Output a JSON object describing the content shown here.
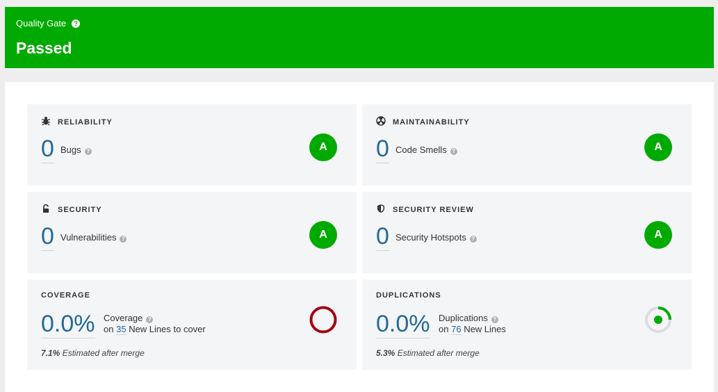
{
  "gate": {
    "label": "Quality Gate",
    "help": "?",
    "status": "Passed"
  },
  "reliability": {
    "title": "RELIABILITY",
    "icon": "bug-icon",
    "value": "0",
    "label": "Bugs",
    "rating": "A"
  },
  "maintainability": {
    "title": "MAINTAINABILITY",
    "icon": "radiation-icon",
    "value": "0",
    "label": "Code Smells",
    "rating": "A"
  },
  "security": {
    "title": "SECURITY",
    "icon": "lock-icon",
    "value": "0",
    "label": "Vulnerabilities",
    "rating": "A"
  },
  "security_review": {
    "title": "SECURITY REVIEW",
    "icon": "shield-icon",
    "value": "0",
    "label": "Security Hotspots",
    "rating": "A"
  },
  "coverage": {
    "title": "COVERAGE",
    "value": "0.0%",
    "label": "Coverage",
    "on": "on",
    "lines": "35",
    "lines_label": "New Lines to cover",
    "estimate": "7.1%",
    "estimate_label": "Estimated after merge",
    "gauge_color": "#a4030f"
  },
  "duplications": {
    "title": "DUPLICATIONS",
    "value": "0.0%",
    "label": "Duplications",
    "on": "on",
    "lines": "76",
    "lines_label": "New Lines",
    "estimate": "5.3%",
    "estimate_label": "Estimated after merge",
    "gauge_color": "#00aa00"
  },
  "help_glyph": "?"
}
